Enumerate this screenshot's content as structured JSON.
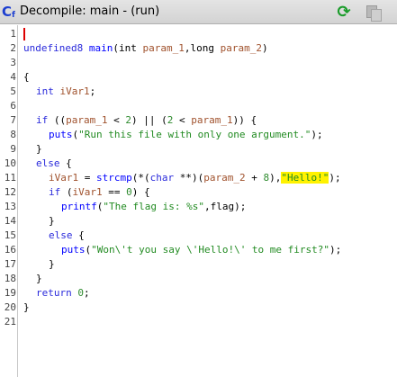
{
  "window": {
    "title": "Decompile: main -  (run)"
  },
  "toolbar": {
    "icon": "ghidra-c-icon",
    "refresh_icon": "refresh-icon",
    "copy_icon": "copy-icon"
  },
  "line_numbers": [
    "1",
    "2",
    "3",
    "4",
    "5",
    "6",
    "7",
    "8",
    "9",
    "10",
    "11",
    "12",
    "13",
    "14",
    "15",
    "16",
    "17",
    "18",
    "19",
    "20",
    "21"
  ],
  "code": {
    "l2_type": "undefined8",
    "l2_name": "main",
    "l2_params_a": "(int ",
    "l2_p1": "param_1",
    "l2_mid": ",long ",
    "l2_p2": "param_2",
    "l2_end": ")",
    "l4": "{",
    "l5_type": "int",
    "l5_var": "iVar1",
    "l5_end": ";",
    "l7_if": "if",
    "l7_a": " ((",
    "l7_p1": "param_1",
    "l7_b": " < ",
    "l7_n2": "2",
    "l7_c": ") || (",
    "l7_n2b": "2",
    "l7_d": " < ",
    "l7_p1b": "param_1",
    "l7_e": ")) {",
    "l8_fn": "puts",
    "l8_a": "(",
    "l8_str": "\"Run this file with only one argument.\"",
    "l8_b": ");",
    "l9": "}",
    "l10_else": "else",
    "l10_b": " {",
    "l11_var": "iVar1",
    "l11_a": " = ",
    "l11_fn": "strcmp",
    "l11_b": "(*(",
    "l11_char": "char",
    "l11_c": " **)(",
    "l11_p2": "param_2",
    "l11_d": " + ",
    "l11_n8": "8",
    "l11_e": "),",
    "l11_str": "\"Hello!\"",
    "l11_f": ");",
    "l12_if": "if",
    "l12_a": " (",
    "l12_var": "iVar1",
    "l12_b": " == ",
    "l12_n0": "0",
    "l12_c": ") {",
    "l13_fn": "printf",
    "l13_a": "(",
    "l13_str": "\"The flag is: %s\"",
    "l13_b": ",flag);",
    "l14": "}",
    "l15_else": "else",
    "l15_b": " {",
    "l16_fn": "puts",
    "l16_a": "(",
    "l16_str": "\"Won\\'t you say \\'Hello!\\' to me first?\"",
    "l16_b": ");",
    "l17": "}",
    "l18": "}",
    "l19_ret": "return",
    "l19_a": " ",
    "l19_n0": "0",
    "l19_b": ";",
    "l20": "}"
  }
}
